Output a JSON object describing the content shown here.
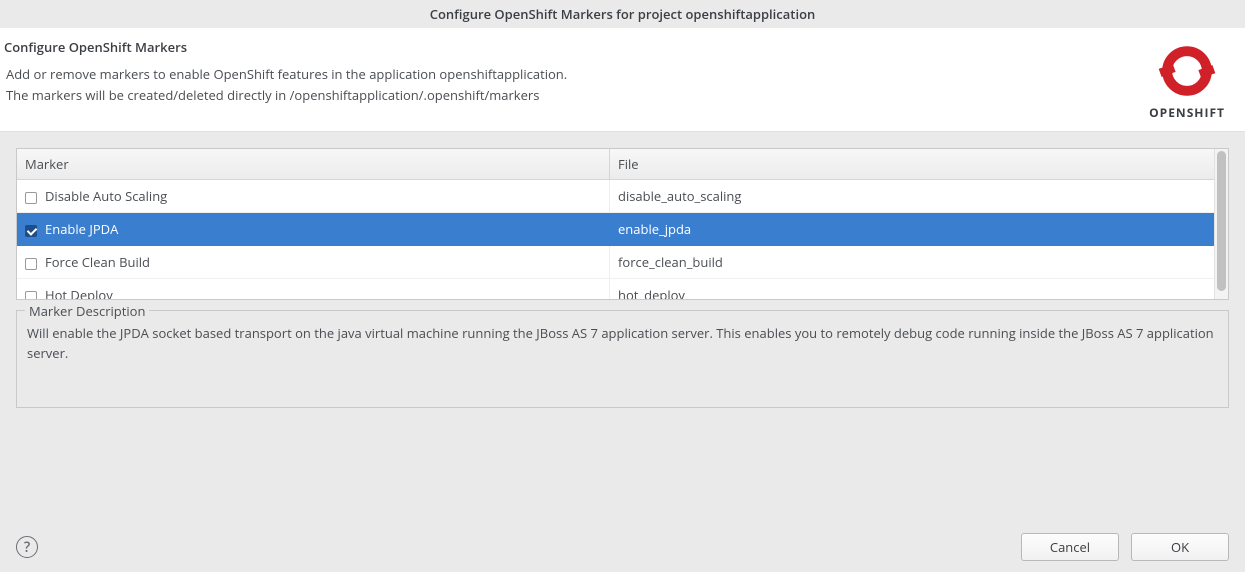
{
  "window": {
    "title": "Configure OpenShift Markers for project openshiftapplication"
  },
  "header": {
    "title": "Configure OpenShift Markers",
    "line1": "Add or remove markers to enable OpenShift features in the application openshiftapplication.",
    "line2": "The markers will be created/deleted directly in /openshiftapplication/.openshift/markers",
    "logo_label": "OPENSHIFT"
  },
  "table": {
    "columns": {
      "marker": "Marker",
      "file": "File"
    },
    "rows": [
      {
        "marker": "Disable Auto Scaling",
        "file": "disable_auto_scaling",
        "checked": false,
        "selected": false
      },
      {
        "marker": "Enable JPDA",
        "file": "enable_jpda",
        "checked": true,
        "selected": true
      },
      {
        "marker": "Force Clean Build",
        "file": "force_clean_build",
        "checked": false,
        "selected": false
      },
      {
        "marker": "Hot Deploy",
        "file": "hot_deploy",
        "checked": false,
        "selected": false
      }
    ]
  },
  "description": {
    "legend": "Marker Description",
    "text": "Will enable the JPDA socket based transport on the java virtual machine running the JBoss AS 7 application server. This enables you to remotely debug code running inside the JBoss AS 7 application server."
  },
  "footer": {
    "help": "?",
    "cancel": "Cancel",
    "ok": "OK"
  },
  "colors": {
    "selection": "#3a7ecf",
    "logo": "#cf2127"
  }
}
